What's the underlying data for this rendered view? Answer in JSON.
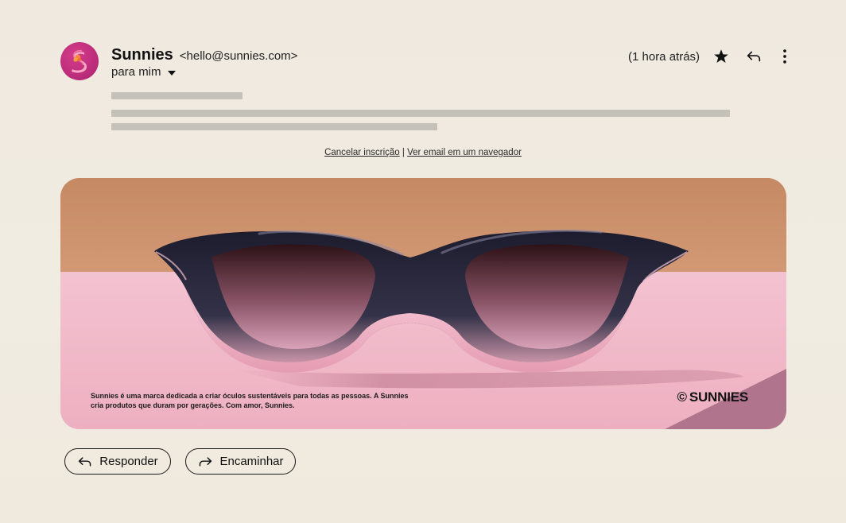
{
  "header": {
    "sender_name": "Sunnies",
    "sender_email": "<hello@sunnies.com>",
    "recipient": "para mim",
    "timestamp": "(1 hora atrás)",
    "icons": [
      "star-icon",
      "reply-icon",
      "more-vertical-icon"
    ]
  },
  "links": {
    "unsubscribe": "Cancelar inscrição",
    "separator": "|",
    "view_in_browser": "Ver email em um navegador"
  },
  "banner": {
    "caption": "Sunnies é uma marca dedicada a criar óculos sustentáveis para todas as pessoas. A Sunnies cria produtos que duram por gerações. Com amor, Sunnies.",
    "brand": "SUNNIES",
    "brand_symbol": "©"
  },
  "actions": {
    "reply_label": "Responder",
    "forward_label": "Encaminhar"
  },
  "colors": {
    "avatar": "#b82a78",
    "background": "#efe9df",
    "placeholder": "#c4c1b9"
  }
}
